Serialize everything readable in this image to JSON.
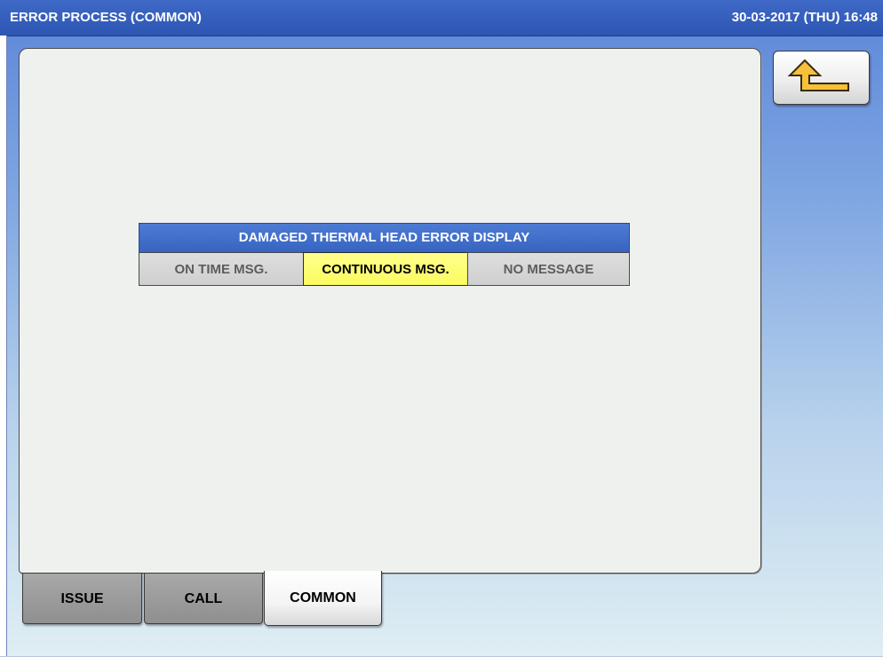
{
  "window": {
    "title": "ERROR PROCESS (COMMON)",
    "datetime": "30-03-2017 (THU)  16:48"
  },
  "back_button": {
    "icon": "return-arrow-icon",
    "accent": "#f5c13a"
  },
  "setting": {
    "header": "DAMAGED THERMAL HEAD ERROR DISPLAY",
    "options": [
      {
        "label": "ON TIME MSG.",
        "selected": false
      },
      {
        "label": "CONTINUOUS MSG.",
        "selected": true
      },
      {
        "label": "NO MESSAGE",
        "selected": false
      }
    ],
    "selected_color": "#ffff80"
  },
  "tabs": [
    {
      "label": "ISSUE",
      "active": false
    },
    {
      "label": "CALL",
      "active": false
    },
    {
      "label": "COMMON",
      "active": true
    }
  ]
}
